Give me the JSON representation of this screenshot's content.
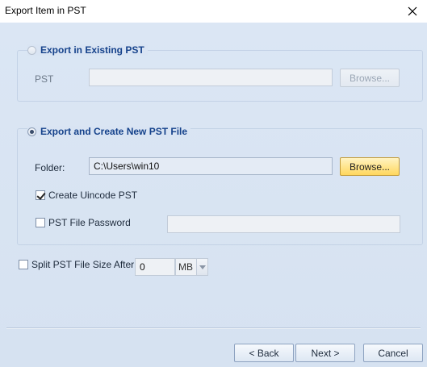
{
  "window": {
    "title": "Export Item in PST"
  },
  "existing": {
    "option_label": "Export in Existing PST",
    "pst_label": "PST",
    "pst_value": "",
    "browse_label": "Browse..."
  },
  "new_pst": {
    "option_label": "Export and Create New PST File",
    "folder_label": "Folder:",
    "folder_value": "C:\\Users\\win10",
    "browse_label": "Browse...",
    "unicode_label": "Create Uincode PST",
    "password_label": "PST File Password",
    "password_value": ""
  },
  "split": {
    "label": "Split PST File Size After",
    "size_value": "0",
    "unit_value": "MB"
  },
  "footer": {
    "back_label": "< Back",
    "next_label": "Next >",
    "cancel_label": "Cancel"
  }
}
